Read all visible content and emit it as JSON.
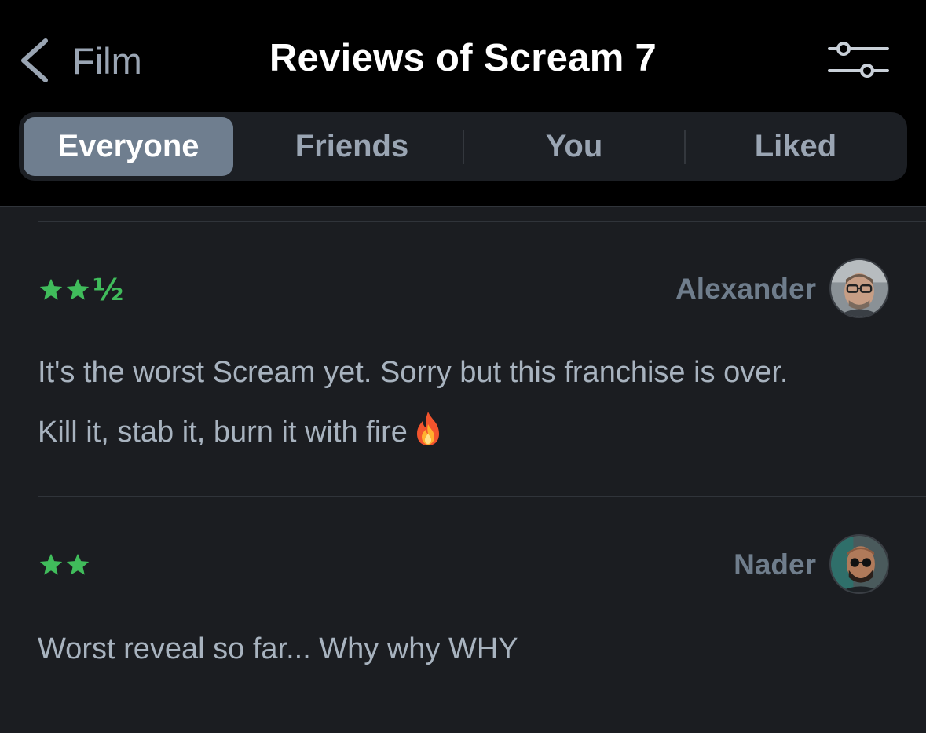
{
  "header": {
    "back_label": "Film",
    "title": "Reviews of Scream 7",
    "back_icon": "chevron-left-icon",
    "filter_icon": "sliders-icon"
  },
  "tabs": [
    {
      "label": "Everyone",
      "active": true
    },
    {
      "label": "Friends",
      "active": false
    },
    {
      "label": "You",
      "active": false
    },
    {
      "label": "Liked",
      "active": false
    }
  ],
  "reviews": [
    {
      "rating": 2.5,
      "rating_half_glyph": "½",
      "reviewer": "Alexander",
      "line1": "It's the worst Scream yet. Sorry but this franchise is over.",
      "line2": "Kill it, stab it, burn it with fire",
      "emoji": "fire-icon"
    },
    {
      "rating": 2,
      "reviewer": "Nader",
      "line1": "Worst reveal so far... Why why WHY"
    }
  ],
  "colors": {
    "background": "#1b1d21",
    "header_bg": "#000000",
    "star_green": "#40bc5b",
    "active_tab": "#6f7e8f",
    "reviewer_name": "#6f7d8c",
    "body_text": "#a8b3bf"
  }
}
